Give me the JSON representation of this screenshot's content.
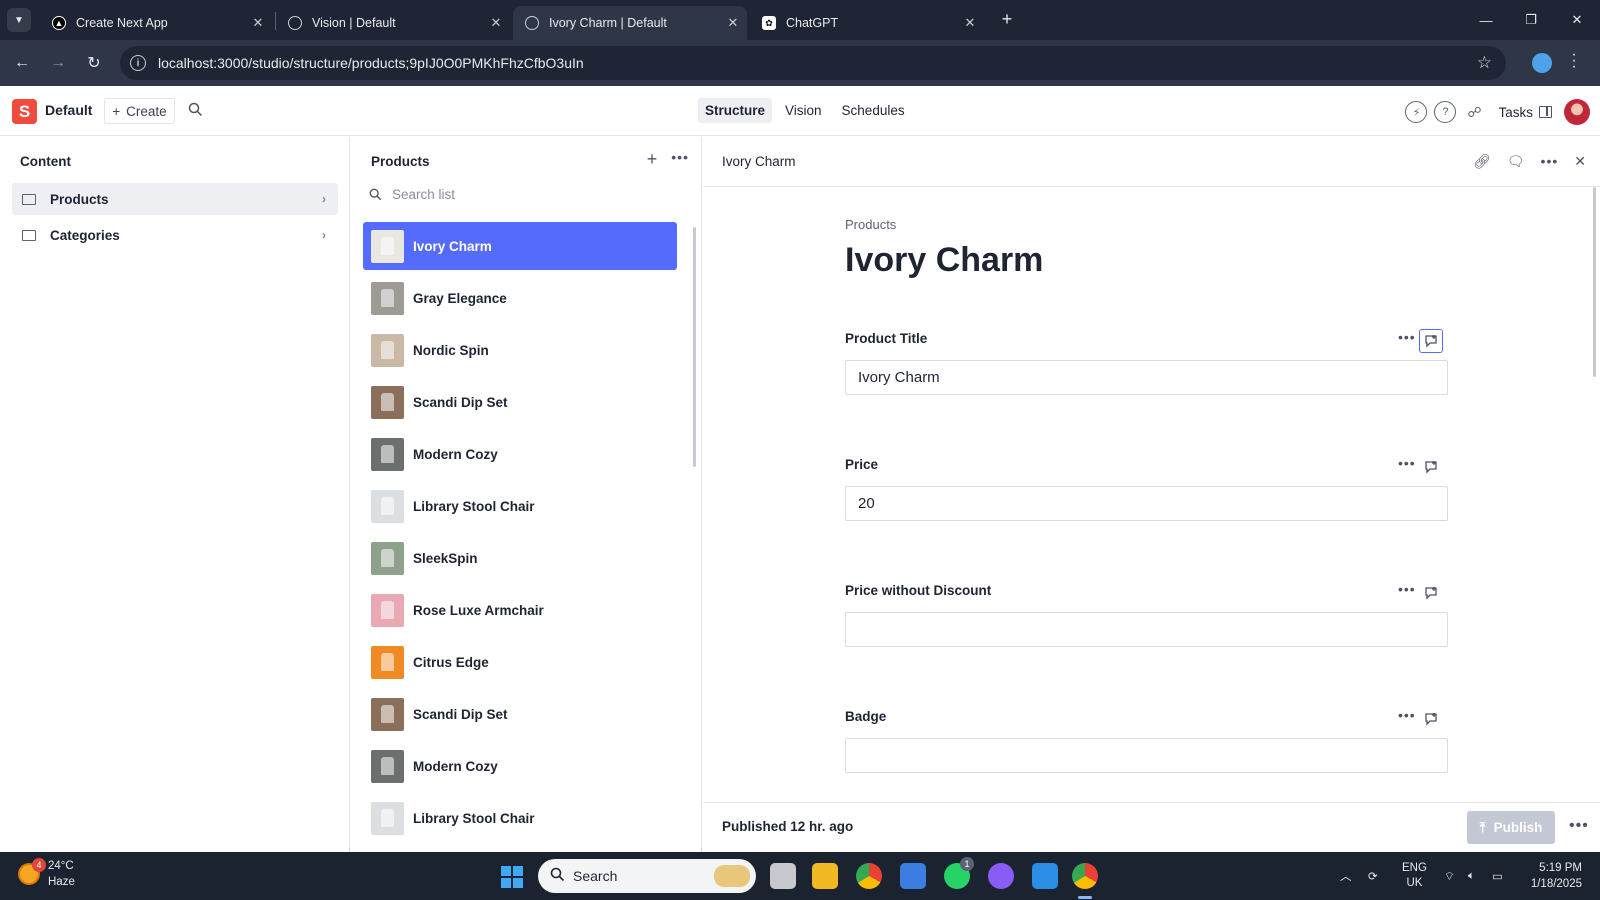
{
  "browser": {
    "tabs": [
      {
        "title": "Create Next App",
        "active": false
      },
      {
        "title": "Vision | Default",
        "active": false
      },
      {
        "title": "Ivory Charm | Default",
        "active": true
      },
      {
        "title": "ChatGPT",
        "active": false
      }
    ],
    "url": "localhost:3000/studio/structure/products;9pIJ0O0PMKhFhzCfbO3uIn"
  },
  "studio": {
    "workspace": "Default",
    "logo_letter": "S",
    "create_label": "Create",
    "nav": [
      "Structure",
      "Vision",
      "Schedules"
    ],
    "active_nav": "Structure",
    "tasks_label": "Tasks"
  },
  "content_pane": {
    "title": "Content",
    "items": [
      {
        "label": "Products",
        "selected": true
      },
      {
        "label": "Categories",
        "selected": false
      }
    ]
  },
  "list_pane": {
    "title": "Products",
    "search_placeholder": "Search list",
    "items": [
      {
        "label": "Ivory Charm",
        "selected": true,
        "thumb": "#e9e7e2"
      },
      {
        "label": "Gray Elegance",
        "thumb": "#9e9a94"
      },
      {
        "label": "Nordic Spin",
        "thumb": "#c9b9a6"
      },
      {
        "label": "Scandi Dip Set",
        "thumb": "#8b6f5a"
      },
      {
        "label": "Modern Cozy",
        "thumb": "#6b6f6e"
      },
      {
        "label": "Library Stool Chair",
        "thumb": "#dcdfe2"
      },
      {
        "label": "SleekSpin",
        "thumb": "#8fa08c"
      },
      {
        "label": "Rose Luxe Armchair",
        "thumb": "#e8a9b4"
      },
      {
        "label": "Citrus Edge",
        "thumb": "#f08a24"
      },
      {
        "label": "Scandi Dip Set",
        "thumb": "#8b6f5a"
      },
      {
        "label": "Modern Cozy",
        "thumb": "#6b6f6e"
      },
      {
        "label": "Library Stool Chair",
        "thumb": "#dcdfe2"
      }
    ]
  },
  "document": {
    "header_title": "Ivory Charm",
    "breadcrumb": "Products",
    "title": "Ivory Charm",
    "fields": [
      {
        "label": "Product Title",
        "value": "Ivory Charm"
      },
      {
        "label": "Price",
        "value": "20"
      },
      {
        "label": "Price without Discount",
        "value": ""
      },
      {
        "label": "Badge",
        "value": ""
      }
    ],
    "status": "Published 12 hr. ago",
    "publish_label": "Publish"
  },
  "taskbar": {
    "weather_temp": "24°C",
    "weather_desc": "Haze",
    "weather_badge": "4",
    "search_label": "Search",
    "whatsapp_badge": "1",
    "lang_1": "ENG",
    "lang_2": "UK",
    "time": "5:19 PM",
    "date": "1/18/2025"
  },
  "colors": {
    "accent": "#556bfc",
    "brand": "#f04b3e",
    "chrome_dark": "#1f2534"
  }
}
